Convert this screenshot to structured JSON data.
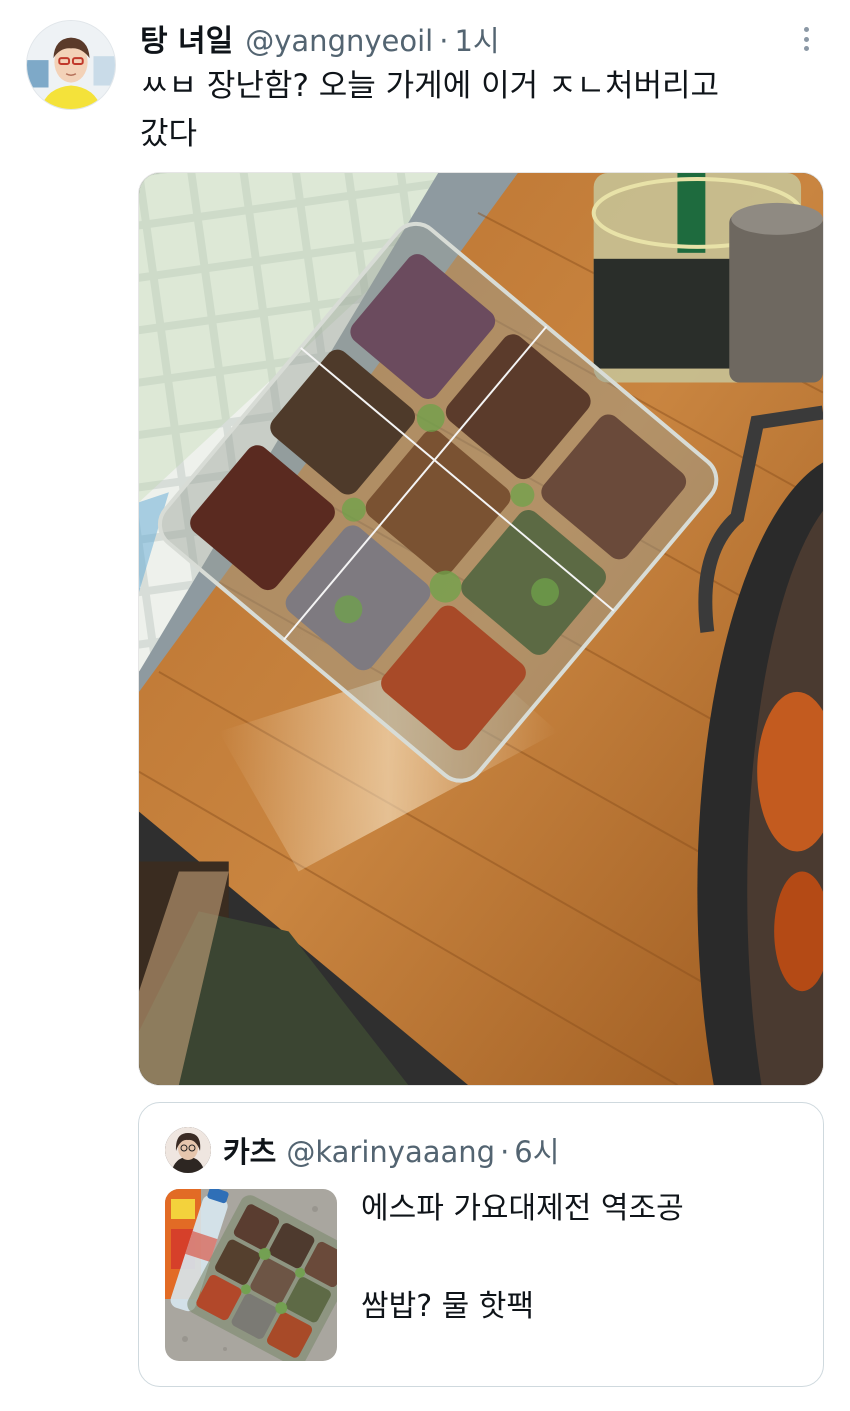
{
  "tweet": {
    "display_name": "탕 녀일",
    "handle": "@yangnyeoil",
    "separator": "·",
    "time": "1시",
    "text_line1": "ㅆㅂ 장난함? 오늘 가게에 이거 ㅈㄴ처버리고",
    "text_line2": "갔다",
    "more_icon": "more-vertical-icon"
  },
  "quote": {
    "display_name": "카츠",
    "handle": "@karinyaaang",
    "separator": "·",
    "time": "6시",
    "text_line1": "에스파 가요대제전 역조공",
    "text_line2": "쌈밥? 물 핫팩"
  },
  "colors": {
    "text_primary": "#0f1419",
    "text_secondary": "#536471",
    "border": "#cfd9de"
  }
}
